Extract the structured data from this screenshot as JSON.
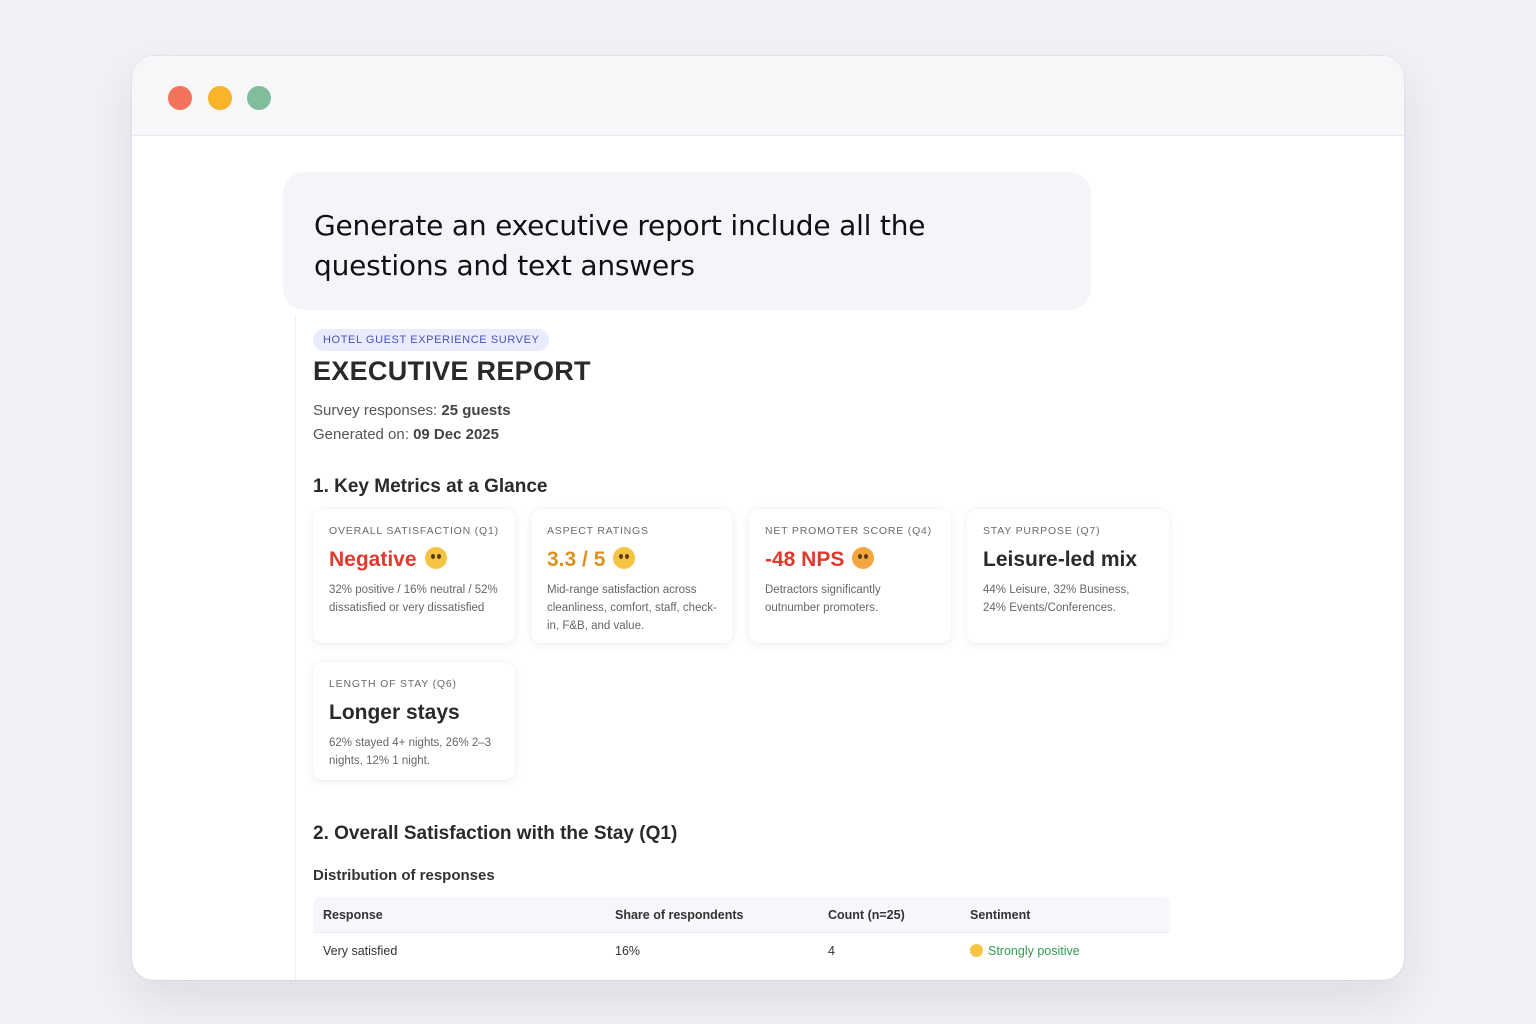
{
  "prompt": {
    "text": "Generate an executive report include all the questions and text answers"
  },
  "report": {
    "tag": "HOTEL GUEST EXPERIENCE SURVEY",
    "title": "EXECUTIVE REPORT",
    "responses_label": "Survey responses:",
    "responses_value": "25 guests",
    "generated_label": "Generated on:",
    "generated_value": "09 Dec 2025",
    "section1_title": "1. Key Metrics at a Glance",
    "cards": [
      {
        "label": "OVERALL SATISFACTION (Q1)",
        "value": "Negative",
        "color": "#e03a2f",
        "icon": "flushed-face-icon",
        "desc": "32% positive / 16% neutral / 52% dissatisfied or very dissatisfied"
      },
      {
        "label": "ASPECT RATINGS",
        "value": "3.3 / 5",
        "color": "#d9931f",
        "icon": "neutral-face-icon",
        "desc": "Mid-range satisfaction across cleanliness, comfort, staff, check-in, F&B, and value."
      },
      {
        "label": "NET PROMOTER SCORE (Q4)",
        "value": "-48 NPS",
        "color": "#e03a2f",
        "icon": "confounded-face-icon",
        "desc": "Detractors significantly outnumber promoters."
      },
      {
        "label": "STAY PURPOSE (Q7)",
        "value": "Leisure-led mix",
        "color": "#2a2a2a",
        "desc": "44% Leisure, 32% Business, 24% Events/Conferences."
      },
      {
        "label": "LENGTH OF STAY (Q6)",
        "value": "Longer stays",
        "color": "#2a2a2a",
        "desc": "62% stayed 4+ nights, 26% 2–3 nights, 12% 1 night."
      }
    ],
    "section2_title": "2. Overall Satisfaction with the Stay (Q1)",
    "distribution_label": "Distribution of responses",
    "table": {
      "headers": [
        "Response",
        "Share of respondents",
        "Count (n=25)",
        "Sentiment"
      ],
      "rows": [
        {
          "response": "Very satisfied",
          "share": "16%",
          "count": "4",
          "sentiment": "Strongly positive",
          "sentiment_color": "#2f9d52"
        }
      ]
    }
  }
}
